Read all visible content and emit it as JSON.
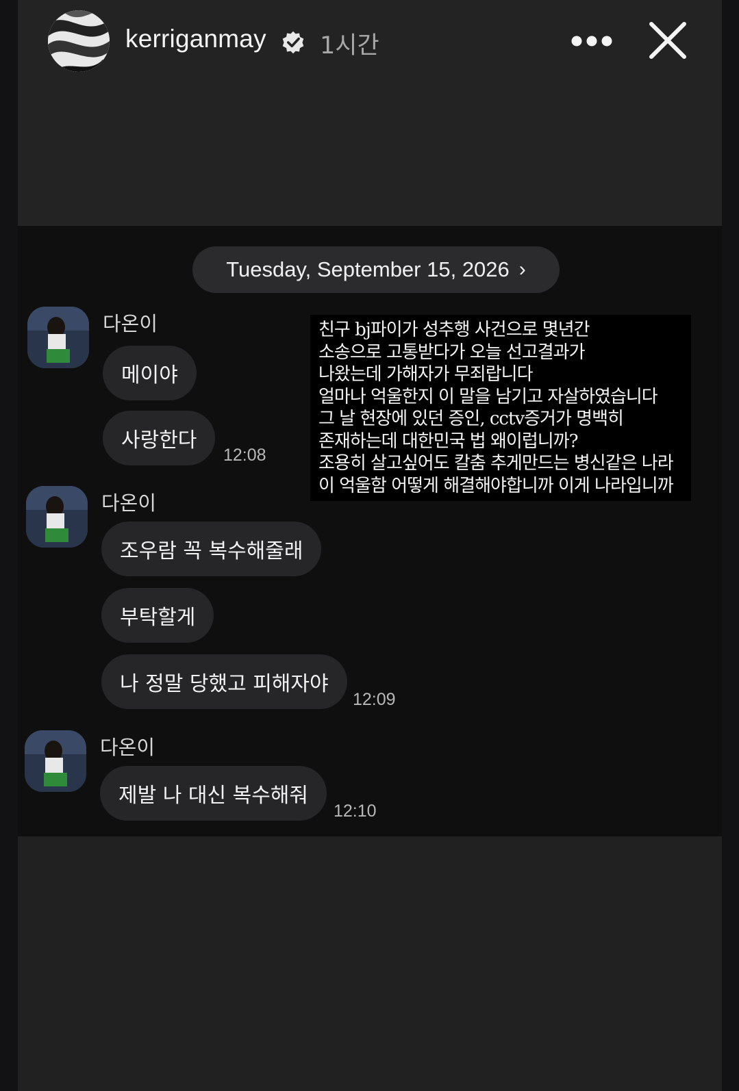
{
  "header": {
    "username": "kerriganmay",
    "time_ago": "1시간"
  },
  "chat": {
    "date_label": "Tuesday, September 15, 2026",
    "groups": [
      {
        "sender": "다온이",
        "messages": [
          "메이야",
          "사랑한다"
        ],
        "time": "12:08"
      },
      {
        "sender": "다온이",
        "messages": [
          "조우람 꼭 복수해줄래",
          "부탁할게",
          "나 정말 당했고 피해자야"
        ],
        "time": "12:09"
      },
      {
        "sender": "다온이",
        "messages": [
          "제발 나 대신 복수해줘"
        ],
        "time": "12:10"
      }
    ]
  },
  "overlay_text": [
    "친구 bj파이가 성추행 사건으로 몇년간",
    "소송으로 고통받다가 오늘 선고결과가",
    "나왔는데 가해자가 무죄랍니다",
    "얼마나 억울한지 이 말을 남기고 자살하였습니다",
    "그 날 현장에 있던 증인, cctv증거가 명백히",
    "존재하는데 대한민국 법 왜이럽니까?",
    "조용히 살고싶어도 칼춤 추게만드는 병신같은 나라",
    "이 억울함 어떻게 해결해야합니까 이게 나라입니까"
  ],
  "icons": {
    "verified": "verified-badge-icon",
    "more": "more-options-icon",
    "close": "close-icon",
    "chevron": "chevron-right-icon"
  },
  "colors": {
    "background": "#232323",
    "chat_background": "#0f0f10",
    "bubble": "#262628",
    "text": "#f2f2f2"
  }
}
